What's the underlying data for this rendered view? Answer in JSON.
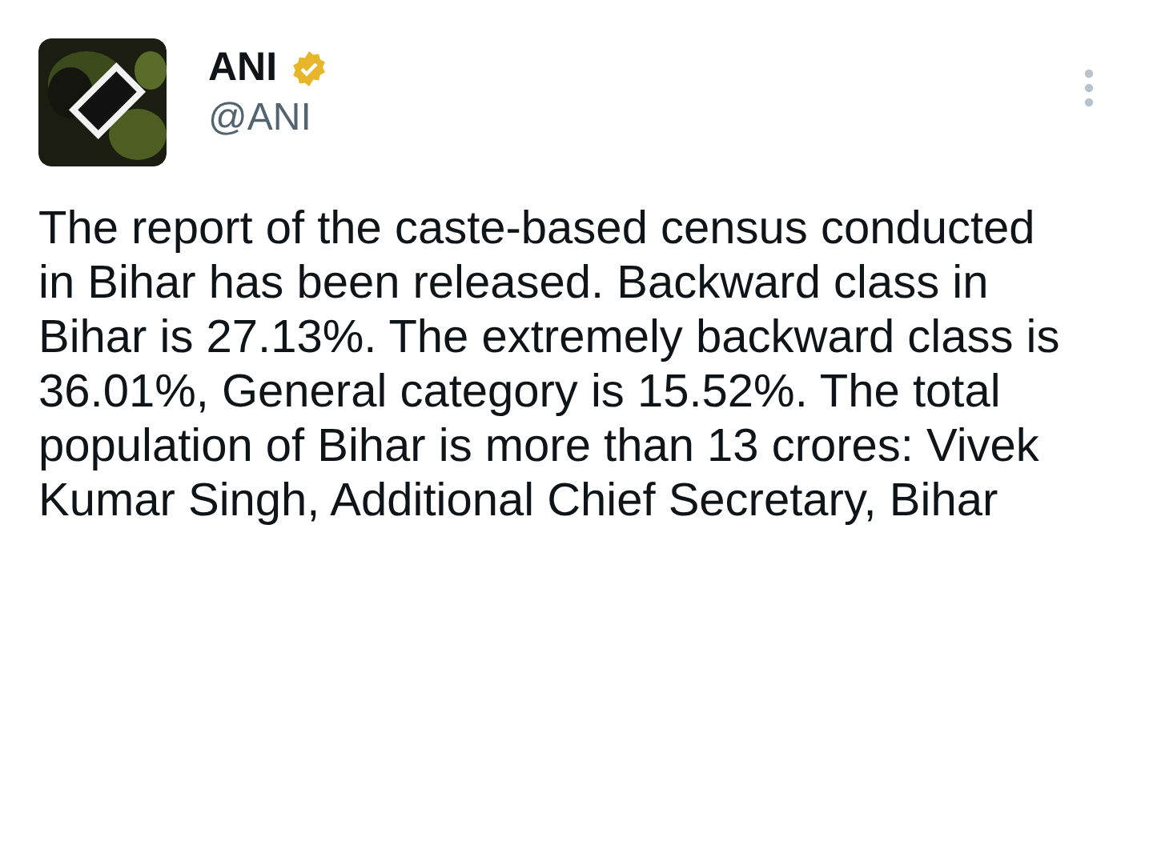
{
  "author": {
    "name": "ANI",
    "verified": true,
    "handle": "@ANI"
  },
  "text": "The report of the caste-based census conducted in Bihar has been released. Backward class in Bihar is 27.13%. The extremely backward class is 36.01%, General category is 15.52%. The total population of Bihar is more than 13 crores: Vivek Kumar Singh, Additional Chief Secretary, Bihar"
}
